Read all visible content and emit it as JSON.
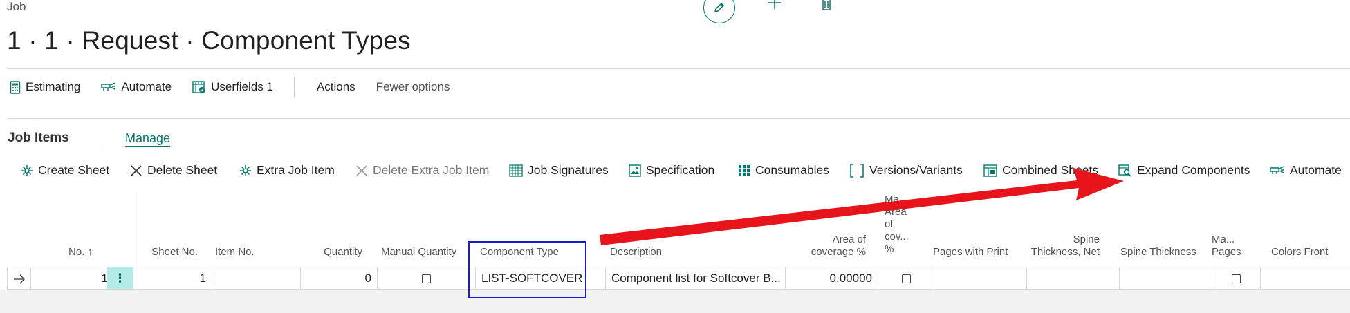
{
  "header": {
    "breadcrumb": "Job",
    "title": "1 · 1 · Request · Component Types"
  },
  "header_actions": [
    {
      "name": "edit",
      "icon": "pencil-icon"
    },
    {
      "name": "new",
      "icon": "plus-icon"
    },
    {
      "name": "delete",
      "icon": "trash-icon"
    }
  ],
  "actionbar": {
    "estimating": "Estimating",
    "automate": "Automate",
    "userfields": "Userfields 1",
    "actions": "Actions",
    "fewer_options": "Fewer options"
  },
  "subpage": {
    "title": "Job Items",
    "manage": "Manage"
  },
  "subactions": {
    "create_sheet": "Create Sheet",
    "delete_sheet": "Delete Sheet",
    "extra_job_item": "Extra Job Item",
    "delete_extra_job_item": "Delete Extra Job Item",
    "job_signatures": "Job Signatures",
    "specification": "Specification",
    "consumables": "Consumables",
    "versions_variants": "Versions/Variants",
    "combined_sheets": "Combined Sheets",
    "expand_components": "Expand Components",
    "automate": "Automate"
  },
  "grid": {
    "headers": {
      "no": "No. ↑",
      "sheet_no": "Sheet No.",
      "item_no": "Item No.",
      "quantity": "Quantity",
      "manual_quantity": "Manual Quantity",
      "component_type": "Component Type",
      "description": "Description",
      "area_of_coverage_1": "Area of",
      "area_of_coverage_2": "coverage %",
      "ma_area_1": "Ma...",
      "ma_area_2": "Area",
      "ma_area_3": "of",
      "ma_area_4": "cov...",
      "ma_area_5": "%",
      "pages_with_print": "Pages with Print",
      "spine_net_1": "Spine",
      "spine_net_2": "Thickness, Net",
      "spine_thickness": "Spine Thickness",
      "ma_pages_1": "Ma...",
      "ma_pages_2": "Pages",
      "colors_front": "Colors Front"
    },
    "row": {
      "no": "1",
      "sheet_no": "1",
      "item_no": "",
      "quantity": "0",
      "manual_quantity": false,
      "component_type": "LIST-SOFTCOVER",
      "description": "Component list for Softcover B...",
      "area_of_coverage": "0,00000",
      "manual_area": false,
      "manual_pages": false
    }
  },
  "colors": {
    "accent": "#00786e",
    "annotation_arrow": "#e8141b",
    "annotation_box": "#1a1ad6"
  }
}
